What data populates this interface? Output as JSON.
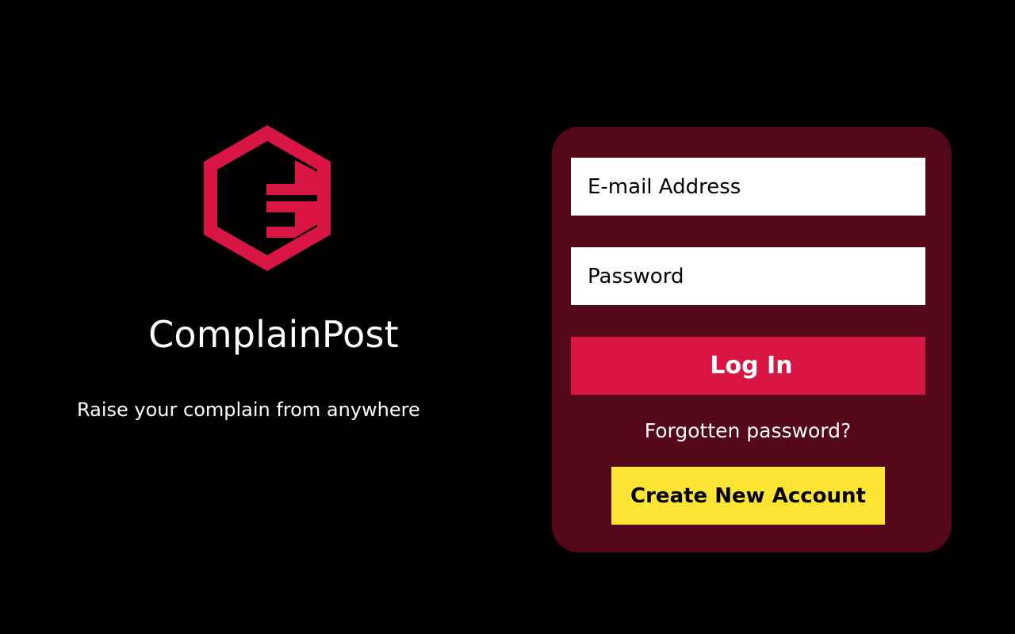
{
  "brand": {
    "name": "ComplainPost",
    "tagline": "Raise your complain from anywhere",
    "logo_icon": "hexagon-e-logo-icon",
    "accent_color": "#d81543"
  },
  "login": {
    "email_placeholder": "E-mail Address",
    "email_value": "",
    "password_placeholder": "Password",
    "password_value": "",
    "login_label": "Log In",
    "forgot_label": "Forgotten password?",
    "create_label": "Create New Account"
  },
  "colors": {
    "background": "#000000",
    "card": "#54081a",
    "primary_button": "#d81543",
    "secondary_button": "#ffe533",
    "text": "#ffffff"
  }
}
